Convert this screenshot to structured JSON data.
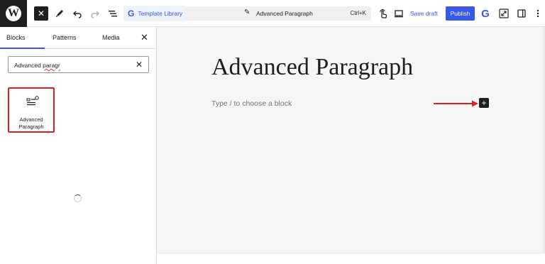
{
  "toolbar": {
    "logo_letter": "W",
    "close_symbol": "✕",
    "template_library_icon": "G",
    "template_library_label": "Template Library",
    "document_title": "Advanced Paragraph",
    "document_shortcut": "Ctrl+K",
    "save_draft_label": "Save draft",
    "publish_label": "Publish",
    "gutenkit_letter": "G"
  },
  "sidebar": {
    "tabs": [
      {
        "label": "Blocks",
        "active": true
      },
      {
        "label": "Patterns",
        "active": false
      },
      {
        "label": "Media",
        "active": false
      }
    ],
    "close_symbol": "✕",
    "search": {
      "value_prefix": "Advanced ",
      "value_misspelled": "paragr",
      "clear_symbol": "✕"
    },
    "results": [
      {
        "label": "Advanced Paragraph",
        "icon": "advanced-paragraph-icon"
      }
    ]
  },
  "canvas": {
    "post_title": "Advanced Paragraph",
    "block_placeholder": "Type / to choose a block",
    "add_block_symbol": "+",
    "annotation_color": "#e01e1e"
  },
  "colors": {
    "accent": "#3858e9",
    "dark": "#1e1e1e",
    "highlight": "#e01e1e"
  }
}
